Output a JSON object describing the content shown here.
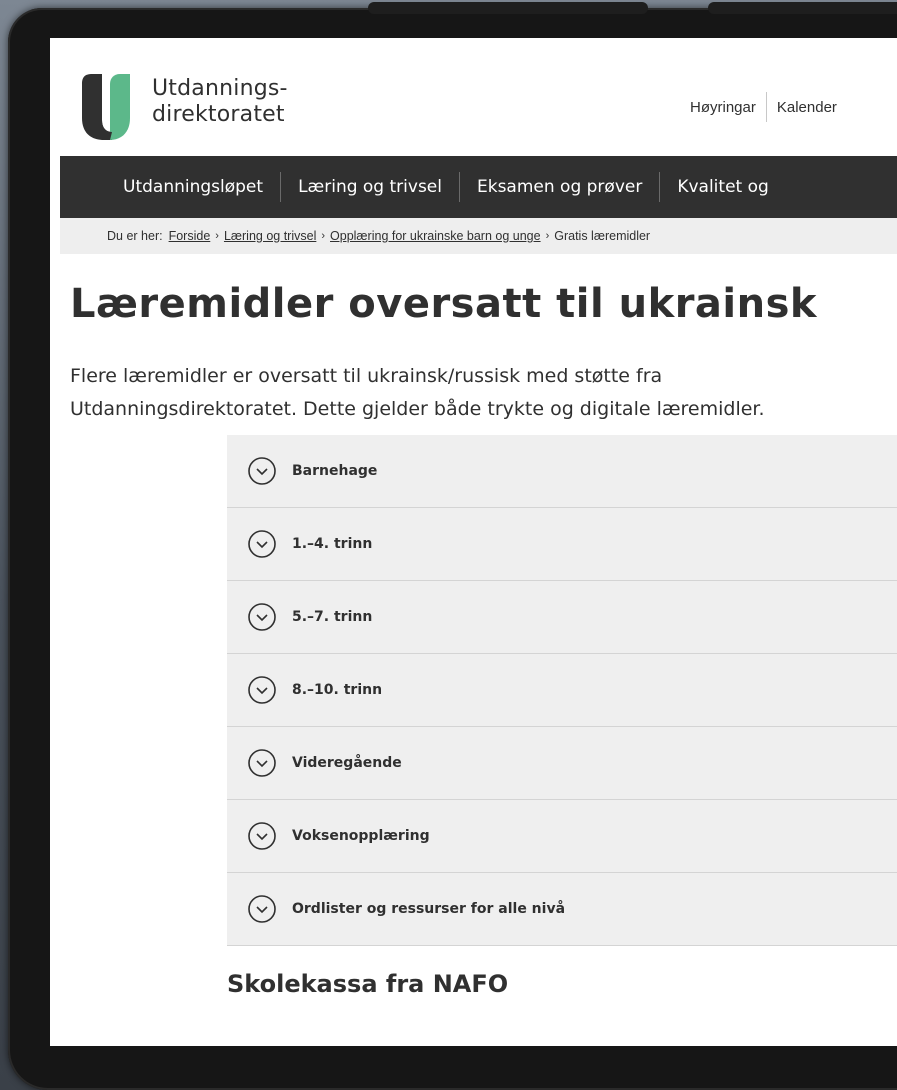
{
  "header": {
    "logo_line1": "Utdannings-",
    "logo_line2": "direktoratet",
    "top_links": [
      "Høyringar",
      "Kalender"
    ],
    "brand_colors": {
      "dark": "#303030",
      "green": "#5cb88a"
    }
  },
  "nav": {
    "items": [
      "Utdanningsløpet",
      "Læring og trivsel",
      "Eksamen og prøver",
      "Kvalitet og"
    ]
  },
  "breadcrumb": {
    "lead": "Du er her:",
    "links": [
      "Forside",
      "Læring og trivsel",
      "Opplæring for ukrainske barn og unge"
    ],
    "current": "Gratis læremidler"
  },
  "page": {
    "title": "Læremidler oversatt til ukrainsk",
    "lead": "Flere læremidler er oversatt til ukrainsk/russisk med støtte fra Utdanningsdirektoratet. Dette gjelder både trykte og digitale læremidler."
  },
  "accordion": {
    "icon": "chevron-down-circle-icon",
    "items": [
      "Barnehage",
      "1.–4. trinn",
      "5.–7. trinn",
      "8.–10. trinn",
      "Videregående",
      "Voksenopplæring",
      "Ordlister og ressurser for alle nivå"
    ]
  },
  "section": {
    "heading": "Skolekassa fra NAFO"
  }
}
